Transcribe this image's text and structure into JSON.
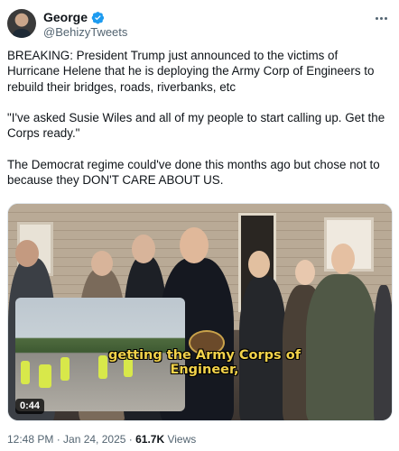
{
  "author": {
    "name": "George",
    "handle": "@BehizyTweets",
    "verified_color": "#1d9bf0"
  },
  "tweet": {
    "paragraphs": [
      "BREAKING: President Trump just announced to the victims of Hurricane Helene that he is deploying the Army Corp of Engineers to rebuild their bridges, roads, riverbanks, etc",
      "\"I've asked Susie Wiles and all of my people to start calling up. Get the Corps ready.\"",
      "The Democrat regime could've done this months ago but chose not to because they DON'T CARE ABOUT US."
    ]
  },
  "media": {
    "caption": "getting the Army Corps of Engineer,",
    "duration": "0:44"
  },
  "footer": {
    "timestamp": "12:48 PM · Jan 24, 2025 · ",
    "views_count": "61.7K",
    "views_label": " Views"
  },
  "icons": [
    "verified-badge-icon",
    "more-options-icon"
  ]
}
